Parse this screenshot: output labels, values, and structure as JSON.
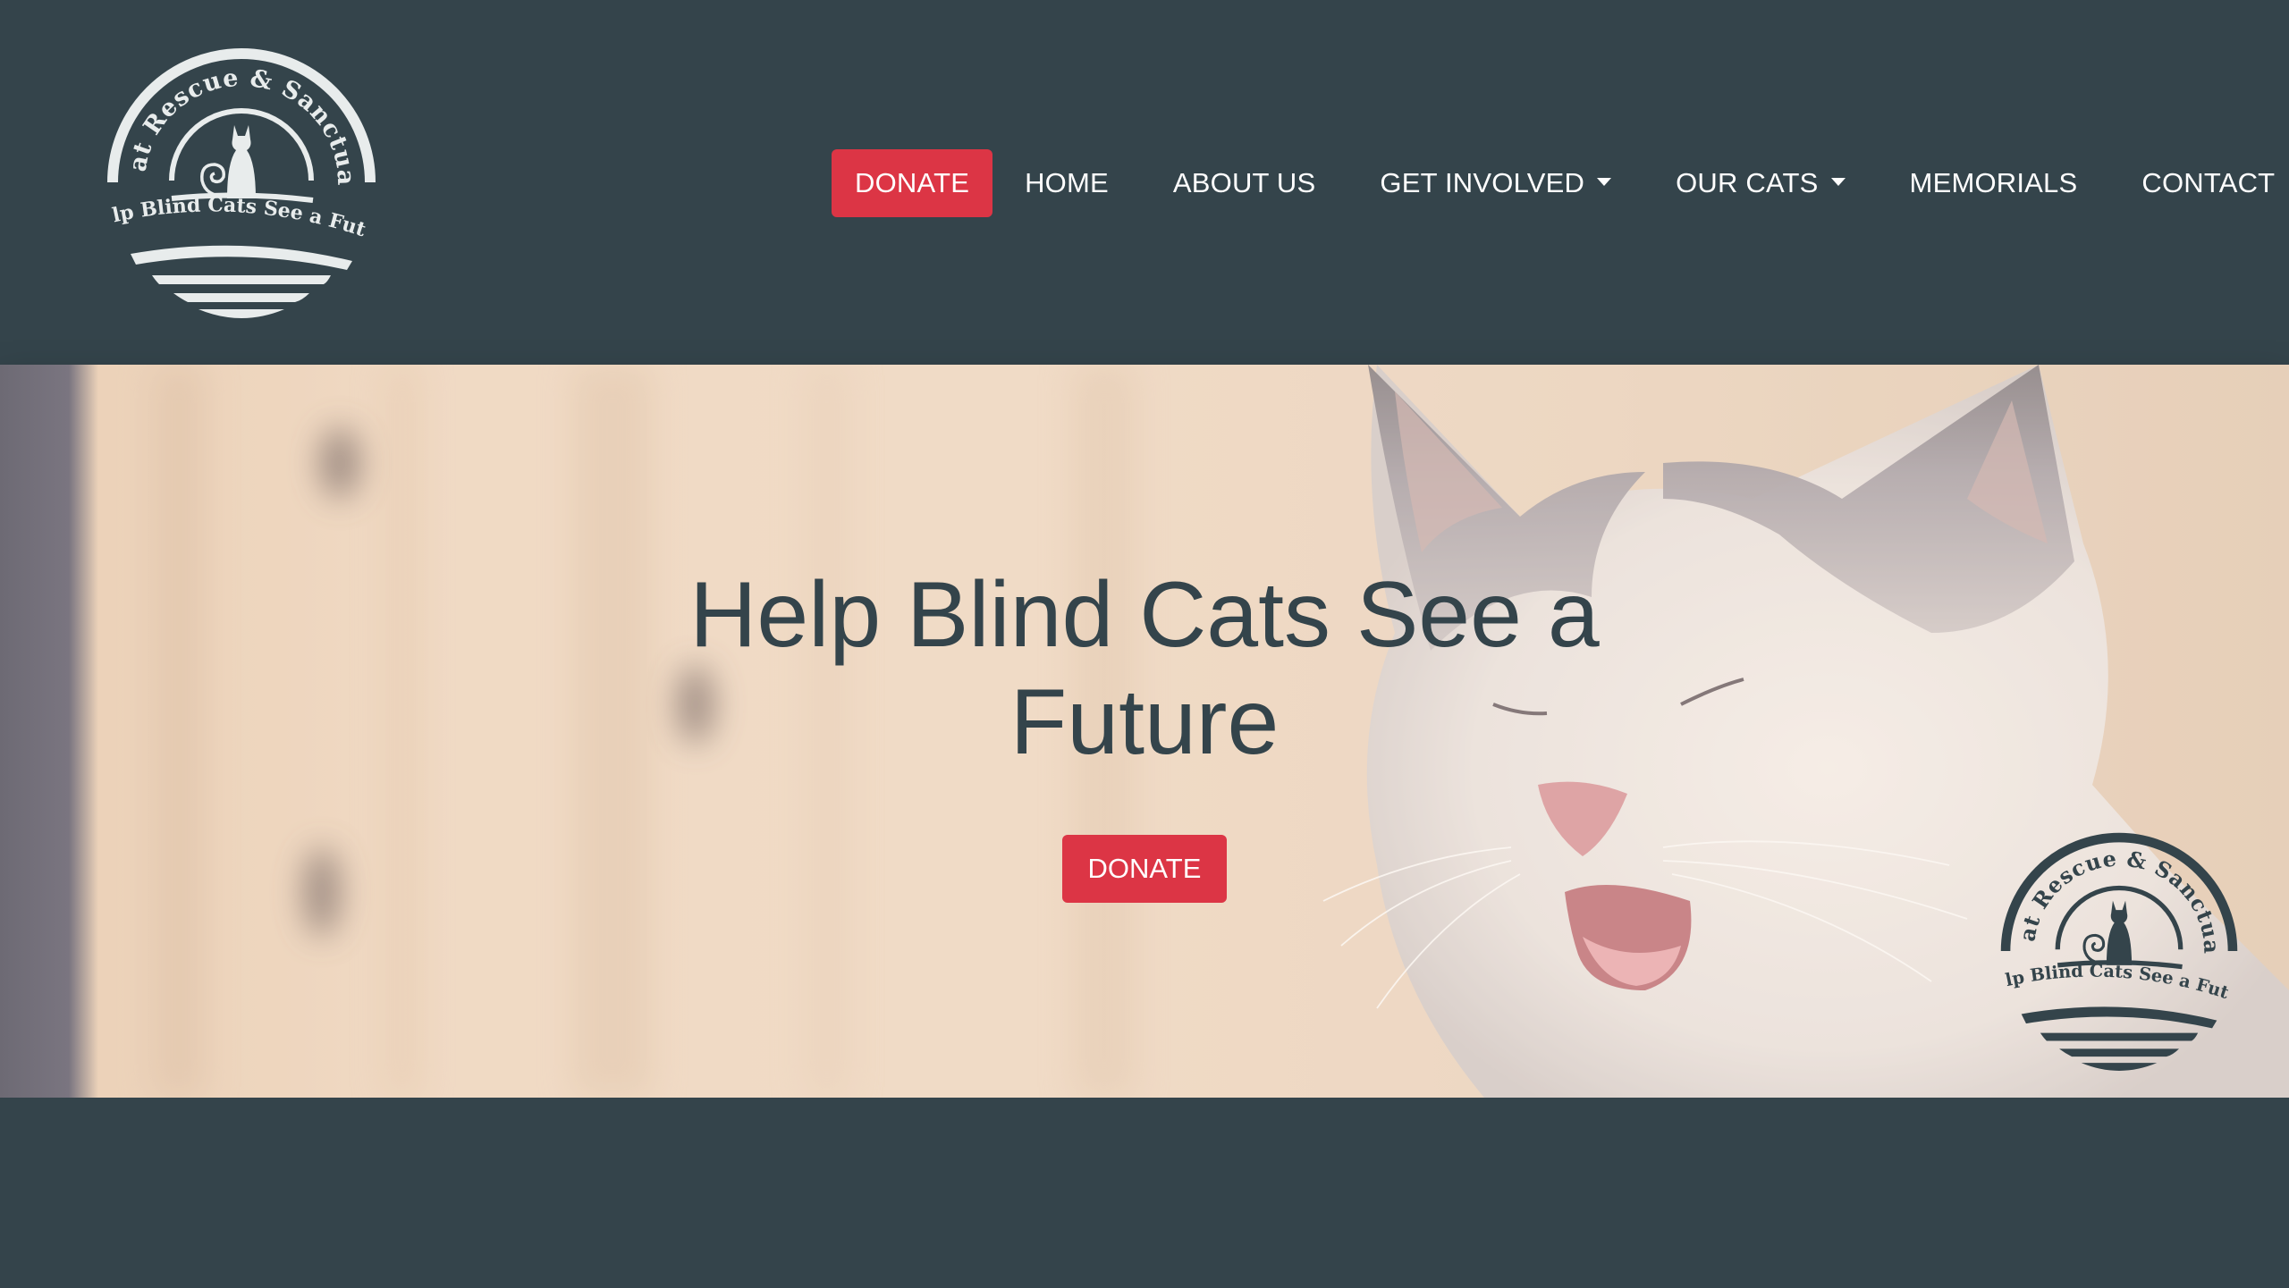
{
  "brand": {
    "logo_arc_text": "Blind Cat Rescue & Sanctuary Inc.",
    "logo_tagline": "Help Blind Cats See a Future",
    "header_logo_color": "#e8ecec",
    "hero_logo_color": "#34444b"
  },
  "nav": {
    "donate": "DONATE",
    "items": [
      {
        "label": "HOME"
      },
      {
        "label": "ABOUT US"
      },
      {
        "label": "GET INVOLVED"
      },
      {
        "label": "OUR CATS"
      },
      {
        "label": "MEMORIALS"
      },
      {
        "label": "CONTACT"
      }
    ]
  },
  "hero": {
    "title": "Help Blind Cats See a Future",
    "donate_label": "DONATE"
  },
  "colors": {
    "background": "#34444b",
    "accent": "#dc3545",
    "text_dark": "#34444b",
    "text_light": "#ffffff"
  }
}
